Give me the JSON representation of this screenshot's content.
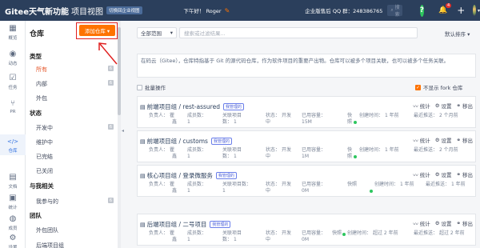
{
  "topbar": {
    "brand": "Gitee天气新功能",
    "brand_sub": "项目视图",
    "switch_label": "切换回企业视图",
    "greeting": "下午好！ Roger",
    "support": "企业版售后 QQ 群：248386765",
    "search_placeholder": "搜索",
    "help": "?",
    "notify_count": "4"
  },
  "rail": [
    {
      "icon": "▦",
      "label": "概览"
    },
    {
      "icon": "◉",
      "label": "动态"
    },
    {
      "icon": "☑",
      "label": "任务"
    },
    {
      "icon": "⑂",
      "label": "PR"
    },
    {
      "icon": "</>",
      "label": "仓库"
    },
    {
      "icon": "▤",
      "label": "文档"
    },
    {
      "icon": "▣",
      "label": "统计"
    },
    {
      "icon": "◍",
      "label": "成员"
    },
    {
      "icon": "⚙",
      "label": "设置"
    }
  ],
  "sidebar": {
    "title": "仓库",
    "add_button": "添加仓库 ▾",
    "groups": [
      {
        "heading": "类型",
        "items": [
          {
            "label": "所有",
            "count": "6"
          },
          {
            "label": "内部",
            "count": "6"
          },
          {
            "label": "外包",
            "count": ""
          }
        ]
      },
      {
        "heading": "状态",
        "items": [
          {
            "label": "开发中",
            "count": "6"
          },
          {
            "label": "维护中",
            "count": ""
          },
          {
            "label": "已完结",
            "count": ""
          },
          {
            "label": "已关闭",
            "count": ""
          }
        ]
      },
      {
        "heading": "与我相关",
        "items": [
          {
            "label": "我参与的",
            "count": "6"
          }
        ]
      },
      {
        "heading": "团队",
        "items": [
          {
            "label": "外包团队",
            "count": ""
          },
          {
            "label": "后端项目组",
            "count": ""
          }
        ]
      }
    ]
  },
  "toolbar": {
    "scope": "全部范围",
    "filter_placeholder": "搜索或过滤结果...",
    "sort": "默认排序 ▾"
  },
  "notice": "在码云（Gitee），仓库特指基于 Git 的源代码仓库，作为软件项目的重要产出物。仓库可以被多个项目关联，也可以被多个任务关联。",
  "batch_label": "批量操作",
  "fork_label": "不显示 fork 仓库",
  "actions": {
    "stats": "统计",
    "settings": "设置",
    "remove": "移出"
  },
  "repos": [
    {
      "title": "前端项目组 / rest-assured",
      "badge": "我管理的",
      "owner_k": "负责人：",
      "owner_v": "瞿",
      "owner_v2": "鑫",
      "members_k": "成员数：",
      "members_v": "1",
      "linked_k": "关联项目",
      "linked_k2": "数：",
      "linked_v": "1",
      "status_k": "状态：",
      "status_v": "开发",
      "status_v2": "中",
      "used_k": "已用容量：",
      "used_v": "15M",
      "speed": "快",
      "speed2": "照",
      "created_k": "创建时间：",
      "created_v": "1 年前",
      "pushed_k": "最近推送：",
      "pushed_v": "2 个月前"
    },
    {
      "title": "前端项目组 / customs",
      "badge": "我管理的",
      "owner_k": "负责人：",
      "owner_v": "瞿",
      "owner_v2": "鑫",
      "members_k": "成员数：",
      "members_v": "1",
      "linked_k": "关联项目",
      "linked_k2": "数：",
      "linked_v": "1",
      "status_k": "状态：",
      "status_v": "开发",
      "status_v2": "中",
      "used_k": "已用容量：",
      "used_v": "1M",
      "speed": "快",
      "speed2": "照",
      "created_k": "创建时间：",
      "created_v": "1 年前",
      "pushed_k": "最近推送：",
      "pushed_v": "2 个月前"
    },
    {
      "title": "核心项目组 / 登录微服务",
      "badge": "我管理的",
      "owner_k": "负责人：",
      "owner_v": "瞿",
      "owner_v2": "鑫",
      "members_k": "成员数：",
      "members_v": "1",
      "linked_k": "关联项目数：",
      "linked_k2": "",
      "linked_v": "1",
      "status_k": "状态：",
      "status_v": "开发",
      "status_v2": "中",
      "used_k": "已用容量：",
      "used_v": "0M",
      "speed": "快照",
      "speed2": "",
      "created_k": "创建时间：",
      "created_v": "1 年前",
      "pushed_k": "最近推送：",
      "pushed_v": "1 年前"
    },
    {
      "title": "后端项目组 / 二号项目",
      "badge": "我管理的",
      "owner_k": "负责人：",
      "owner_v": "瞿",
      "owner_v2": "鑫",
      "members_k": "成员数：",
      "members_v": "1",
      "linked_k": "关联项目",
      "linked_k2": "数：",
      "linked_v": "1",
      "status_k": "状态：",
      "status_v": "开发",
      "status_v2": "中",
      "used_k": "已用容量：",
      "used_v": "0M",
      "speed": "快照",
      "speed2": "",
      "created_k": "创建时间：",
      "created_v": "超过 2 年前",
      "pushed_k": "最近推送：",
      "pushed_v": "超过 2 年前"
    }
  ]
}
